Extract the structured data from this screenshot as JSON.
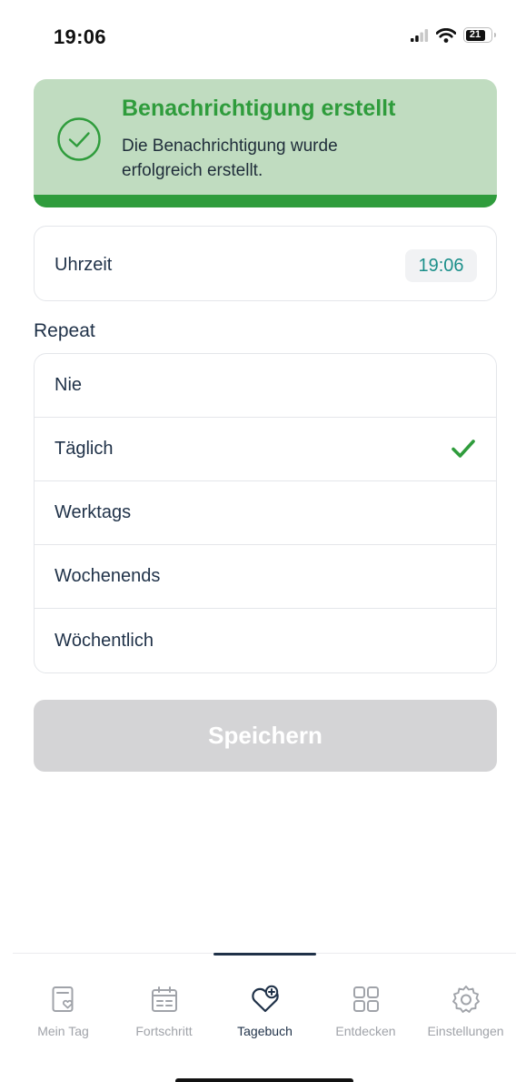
{
  "status_bar": {
    "time": "19:06",
    "battery": "21"
  },
  "toast": {
    "title": "Benachrichtigung erstellt",
    "message": "Die Benachrichtigung wurde erfolgreich erstellt.",
    "color": "#2f9c3c",
    "background": "#c0dcc0"
  },
  "time_setting": {
    "label": "Uhrzeit",
    "value": "19:06"
  },
  "repeat": {
    "section_label": "Repeat",
    "options": [
      {
        "label": "Nie",
        "selected": false
      },
      {
        "label": "Täglich",
        "selected": true
      },
      {
        "label": "Werktags",
        "selected": false
      },
      {
        "label": "Wochenends",
        "selected": false
      },
      {
        "label": "Wöchentlich",
        "selected": false
      }
    ]
  },
  "save_button": {
    "label": "Speichern",
    "enabled": false
  },
  "tab_bar": {
    "active": "Tagebuch",
    "items": [
      {
        "label": "Mein Tag",
        "icon": "day-heart-icon"
      },
      {
        "label": "Fortschritt",
        "icon": "calendar-icon"
      },
      {
        "label": "Tagebuch",
        "icon": "heart-plus-icon"
      },
      {
        "label": "Entdecken",
        "icon": "grid-icon"
      },
      {
        "label": "Einstellungen",
        "icon": "gear-icon"
      }
    ]
  }
}
